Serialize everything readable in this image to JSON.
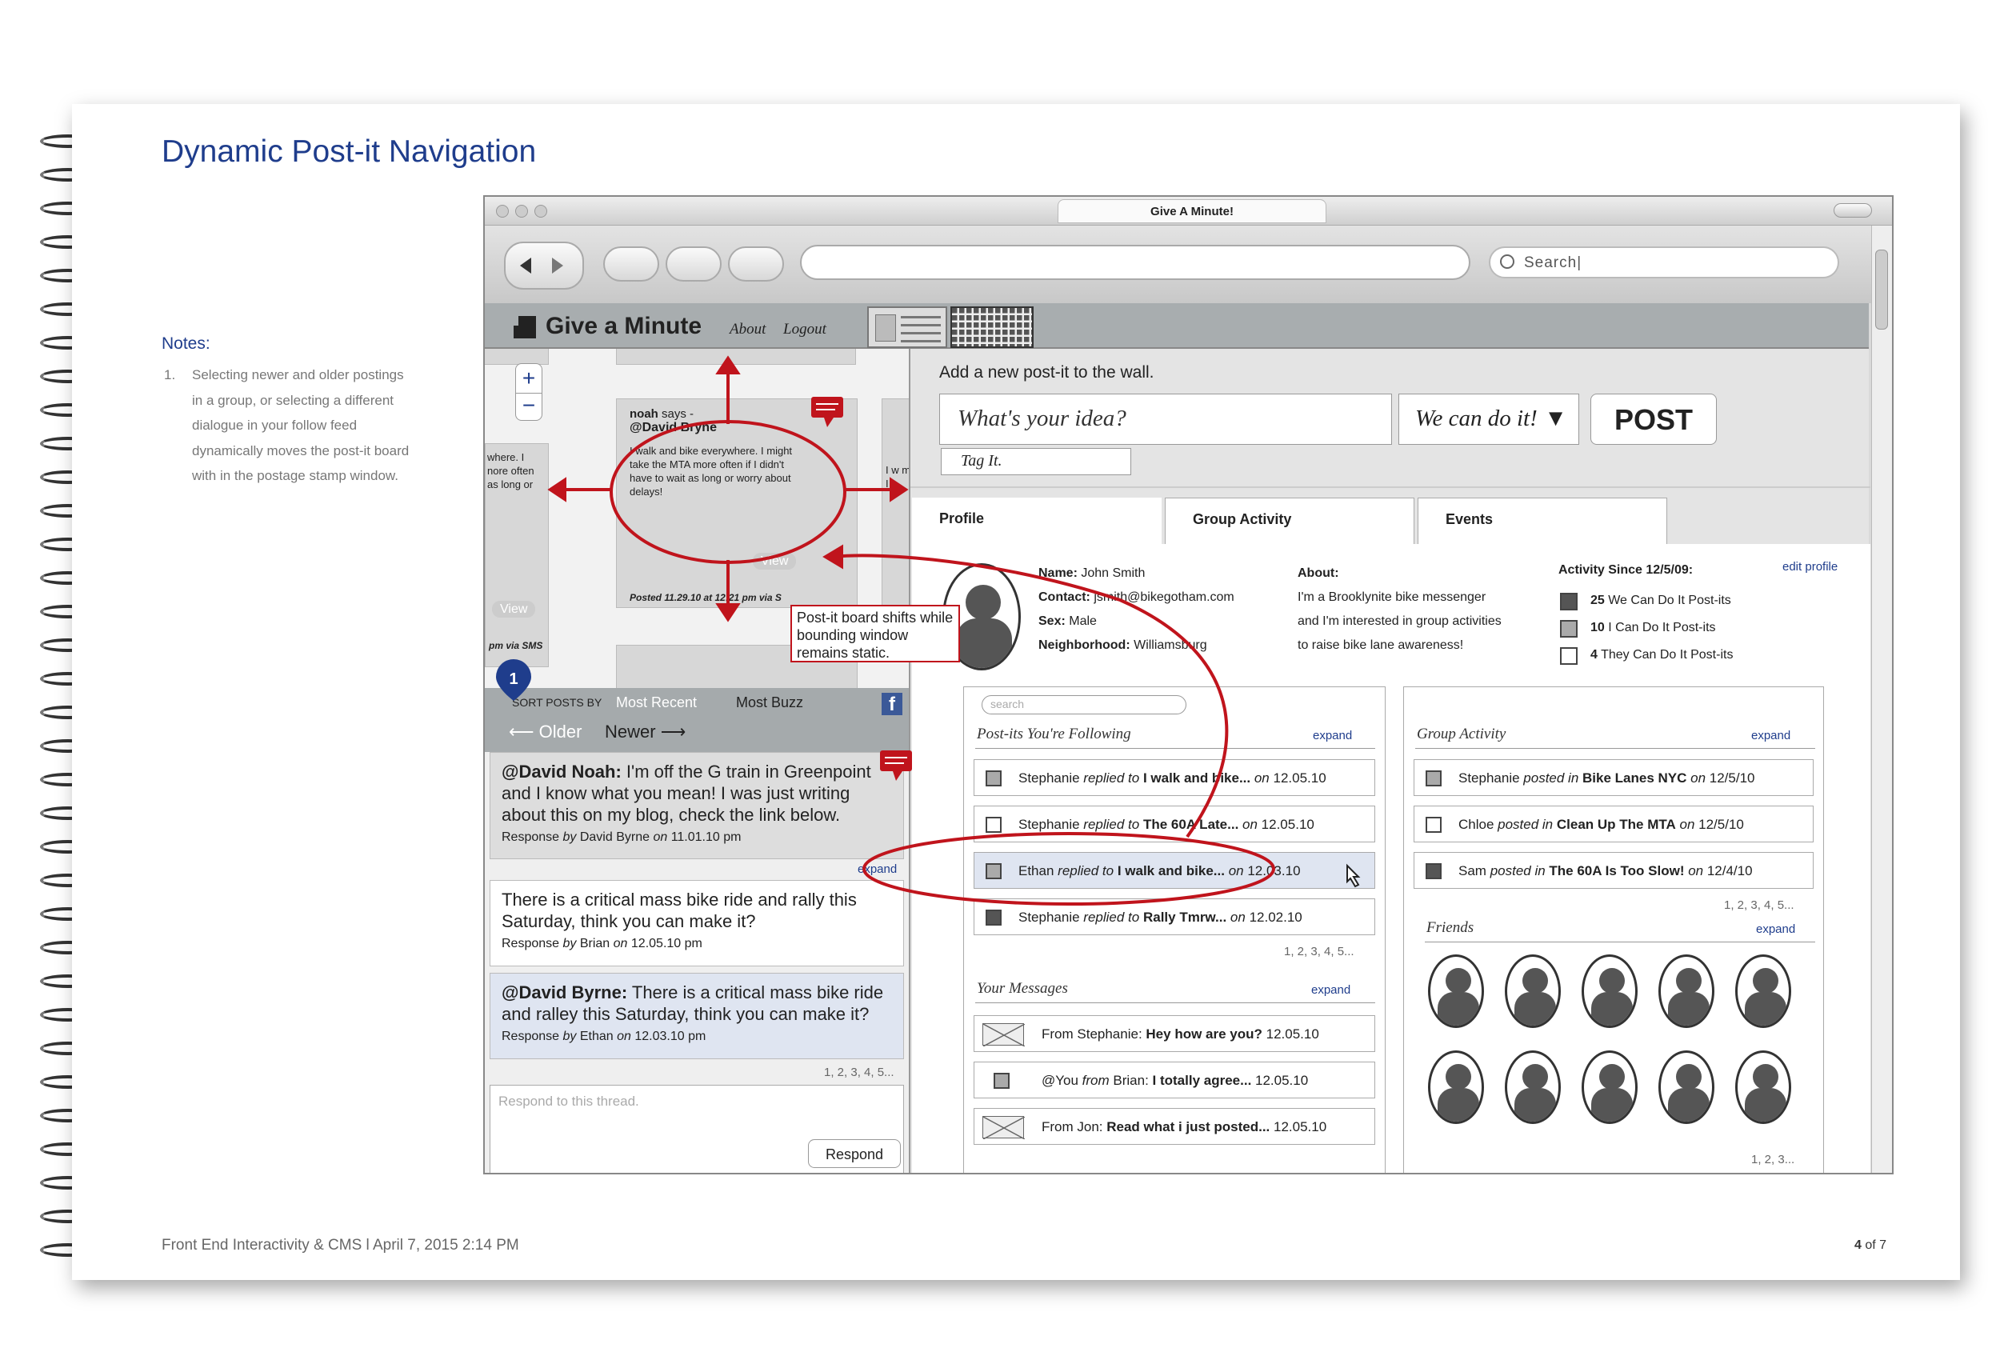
{
  "document": {
    "title": "Dynamic Post-it Navigation",
    "notes_heading": "Notes:",
    "notes": [
      {
        "num": "1.",
        "lines": [
          "Selecting newer and older postings",
          "in a group, or selecting a different",
          "dialogue in your follow feed",
          "dynamically moves the post-it board",
          "with in the postage stamp window."
        ]
      }
    ],
    "footer": "Front End Interactivity & CMS  l April 7, 2015 2:14 PM",
    "page_number": "4",
    "page_of": "of 7"
  },
  "browser": {
    "window_title": "Give A Minute!",
    "search_placeholder": "Search|"
  },
  "app": {
    "logo": "Give a Minute",
    "about": "About",
    "logout": "Logout"
  },
  "board": {
    "center_postit": {
      "says_name": "noah",
      "says_label": "says -",
      "handle": "@David Bryne",
      "text": "I walk and bike everywhere. I might take the MTA more often if I didn't have to wait as long or worry about delays!",
      "view": "View",
      "posted": "Posted 11.29.10 at 12:21 pm via S"
    },
    "left_postit": {
      "text": "where. I nore often as long or",
      "view": "View",
      "via": "pm via SMS"
    },
    "right_postit": {
      "text": "I w mi if I"
    },
    "callout": "Post-it board shifts while bounding window remains static.",
    "badge": "1"
  },
  "sort": {
    "label": "SORT POSTS BY",
    "most_recent": "Most Recent",
    "most_buzz": "Most Buzz",
    "older": "Older",
    "newer": "Newer",
    "fb": "f"
  },
  "thread": {
    "posts": [
      {
        "handle": "@David Noah:",
        "text": " I'm off the G train in Greenpoint and I know what you mean! I was just writing about this on my blog, check the link below.",
        "resp_by": "Response ",
        "by": "by",
        "author": " David Byrne ",
        "on": "on",
        "date": " 11.01.10 pm"
      },
      {
        "handle": "",
        "text": "There is a critical mass bike ride and rally this Saturday, think you can make it?",
        "resp_by": "Response ",
        "by": "by",
        "author": " Brian ",
        "on": "on",
        "date": " 12.05.10 pm"
      },
      {
        "handle": "@David Byrne:",
        "text": " There is a critical mass bike ride and ralley this Saturday, think you can make it?",
        "resp_by": "Response ",
        "by": "by",
        "author": " Ethan ",
        "on": "on",
        "date": " 12.03.10 pm"
      }
    ],
    "expand": "expand",
    "pagination": "1, 2, 3, 4, 5...",
    "respond_placeholder": "Respond to this thread.",
    "respond_button": "Respond"
  },
  "compose": {
    "label": "Add a new post-it to the wall.",
    "idea_placeholder": "What's your idea?",
    "type_select": "We can do it!",
    "post_button": "POST",
    "tag_placeholder": "Tag It."
  },
  "tabs": [
    "Profile",
    "Group Activity",
    "Events"
  ],
  "profile": {
    "name_label": "Name:",
    "name": " John Smith",
    "contact_label": "Contact:",
    "contact": " jsmith@bikegotham.com",
    "sex_label": "Sex:",
    "sex": " Male",
    "hood_label": "Neighborhood:",
    "hood": " Williamsburg",
    "about_label": "About:",
    "about_lines": [
      "I'm a Brooklynite bike messenger",
      "and I'm interested in group activities",
      "to raise bike lane awareness!"
    ],
    "activity_label": "Activity Since 12/5/09:",
    "activity": [
      {
        "count": "25",
        "text": " We Can Do It Post-its",
        "style": "d"
      },
      {
        "count": "10",
        "text": " I Can Do It Post-its",
        "style": "g"
      },
      {
        "count": "4",
        "text": " They Can Do It Post-its",
        "style": ""
      }
    ],
    "edit": "edit profile"
  },
  "following": {
    "search_placeholder": "search",
    "title": "Post-its You're Following",
    "expand": "expand",
    "items": [
      {
        "who": "Stephanie ",
        "verb": "replied to",
        "subject": " I walk and bike...",
        "on": " on",
        "date": " 12.05.10",
        "style": "g"
      },
      {
        "who": "Stephanie ",
        "verb": "replied to",
        "subject": " The 60A Late...",
        "on": " on",
        "date": " 12.05.10",
        "style": ""
      },
      {
        "who": "Ethan ",
        "verb": "replied to",
        "subject": " I walk and bike...",
        "on": " on",
        "date": " 12.03.10",
        "style": "g"
      },
      {
        "who": "Stephanie ",
        "verb": "replied to",
        "subject": " Rally Tmrw...",
        "on": " on",
        "date": " 12.02.10",
        "style": "d"
      }
    ],
    "pagination": "1, 2, 3, 4, 5..."
  },
  "messages": {
    "title": "Your Messages",
    "expand": "expand",
    "items": [
      {
        "pre": "From Stephanie: ",
        "bold": "Hey how are you?",
        "date": " 12.05.10",
        "icon": "envelope-icon"
      },
      {
        "pre": "@You ",
        "mid": "from",
        "pre2": " Brian: ",
        "bold": "I totally agree...",
        "date": " 12.05.10",
        "icon": "checkbox"
      },
      {
        "pre": "From Jon: ",
        "bold": "Read what i just posted...",
        "date": " 12.05.10",
        "icon": "envelope-icon"
      }
    ]
  },
  "group_activity": {
    "title": "Group Activity",
    "expand": "expand",
    "items": [
      {
        "who": "Stephanie ",
        "verb": "posted in",
        "group": " Bike Lanes NYC",
        "on": " on",
        "date": " 12/5/10",
        "style": "g"
      },
      {
        "who": "Chloe ",
        "verb": "posted in",
        "group": " Clean Up The MTA",
        "on": " on",
        "date": " 12/5/10",
        "style": ""
      },
      {
        "who": "Sam ",
        "verb": "posted in",
        "group": " The 60A Is Too Slow!",
        "on": " on",
        "date": " 12/4/10",
        "style": "d"
      }
    ],
    "pagination": "1, 2, 3, 4, 5..."
  },
  "friends": {
    "title": "Friends",
    "expand": "expand",
    "pagination": "1, 2, 3..."
  },
  "colors": {
    "accent": "#1f3d8c",
    "annotation": "#c0141c",
    "badge": "#1f3d8c"
  }
}
